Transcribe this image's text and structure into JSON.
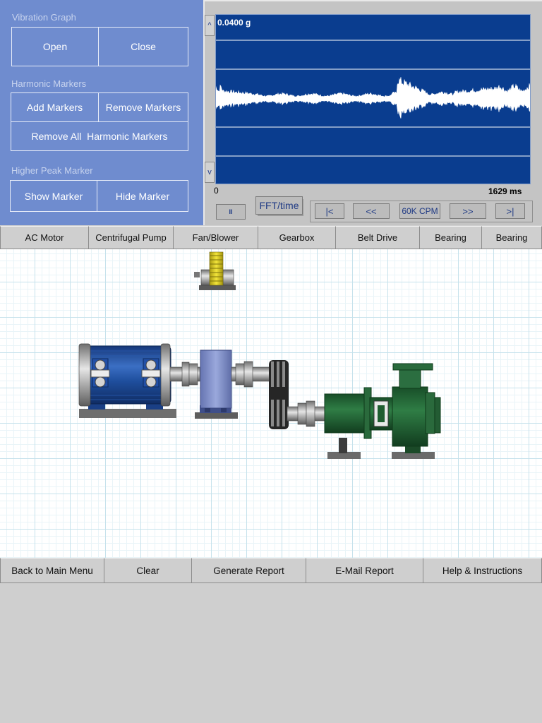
{
  "panel": {
    "vibration_graph": {
      "title": "Vibration Graph",
      "open": "Open",
      "close": "Close"
    },
    "harmonic_markers": {
      "title": "Harmonic Markers",
      "add": "Add Markers",
      "remove": "Remove Markers",
      "remove_all": "Remove All  Harmonic Markers"
    },
    "higher_peak_marker": {
      "title": "Higher Peak Marker",
      "show": "Show Marker",
      "hide": "Hide Marker"
    }
  },
  "graph": {
    "amplitude_label": "0.0400 g",
    "x_start": "0",
    "x_end": "1629 ms",
    "scroll_up": "^",
    "scroll_down": "v",
    "colors": {
      "background": "#0a3d8f",
      "signal": "#ffffff",
      "gridline": "#ffffff"
    }
  },
  "controls": {
    "pause": "II",
    "fft_time": "FFT/time",
    "first": "|<",
    "prev": "<<",
    "range": "60K CPM",
    "next": ">>",
    "last": ">|"
  },
  "component_toolbar": [
    "AC Motor",
    "Centrifugal Pump",
    "Fan/Blower",
    "Gearbox",
    "Belt Drive",
    "Bearing",
    "Bearing"
  ],
  "action_toolbar": [
    "Back to Main Menu",
    "Clear",
    "Generate Report",
    "E-Mail Report",
    "Help & Instructions"
  ],
  "canvas_components": [
    "sensor-bearing",
    "ac-motor",
    "coupling",
    "gearbox",
    "coupling",
    "belt-drive",
    "coupling",
    "centrifugal-pump"
  ],
  "colors": {
    "panel": "#6f8ccf",
    "motor": "#1f4f9e",
    "pump": "#1f6b35",
    "gearbox": "#7f90c9",
    "sensor": "#e3d11f"
  }
}
